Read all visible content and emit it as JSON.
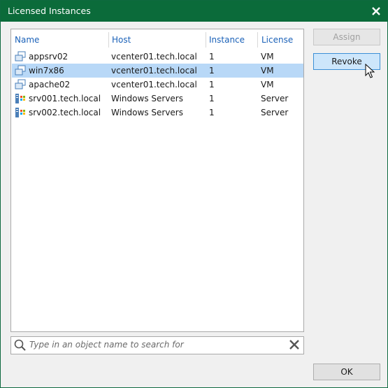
{
  "window": {
    "title": "Licensed Instances"
  },
  "table": {
    "columns": [
      "Name",
      "Host",
      "Instance",
      "License"
    ],
    "rows": [
      {
        "name": "appsrv02",
        "host": "vcenter01.tech.local",
        "instance": "1",
        "license": "VM",
        "icon": "vm-icon"
      },
      {
        "name": "win7x86",
        "host": "vcenter01.tech.local",
        "instance": "1",
        "license": "VM",
        "icon": "vm-icon",
        "selected": true
      },
      {
        "name": "apache02",
        "host": "vcenter01.tech.local",
        "instance": "1",
        "license": "VM",
        "icon": "vm-icon"
      },
      {
        "name": "srv001.tech.local",
        "host": "Windows Servers",
        "instance": "1",
        "license": "Server",
        "icon": "windows-server-icon"
      },
      {
        "name": "srv002.tech.local",
        "host": "Windows Servers",
        "instance": "1",
        "license": "Server",
        "icon": "windows-server-icon"
      }
    ]
  },
  "search": {
    "placeholder": "Type in an object name to search for"
  },
  "buttons": {
    "assign": "Assign",
    "revoke": "Revoke",
    "ok": "OK"
  },
  "colors": {
    "titlebar": "#0b6b3a",
    "header_text": "#1a61b8",
    "selection": "#b8d8f7"
  }
}
